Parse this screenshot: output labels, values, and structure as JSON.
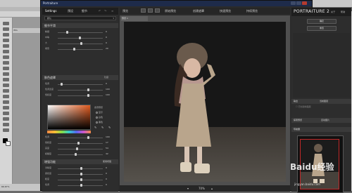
{
  "window": {
    "title": "Portraiture"
  },
  "left_panel": {
    "tabs": [
      "Settings",
      "预设",
      "细节"
    ],
    "preset_label": "默认",
    "section1": "细节平滑",
    "sliders1": [
      {
        "label": "精细",
        "value": "0"
      },
      {
        "label": "中等",
        "value": "0"
      },
      {
        "label": "大",
        "value": "0"
      },
      {
        "label": "阈值",
        "value": "20"
      }
    ],
    "section2": "肤色遮罩",
    "section2_btn": "隐藏",
    "sliders2": [
      {
        "label": "色调",
        "value": "0"
      },
      {
        "label": "色调宽度",
        "value": "100"
      },
      {
        "label": "饱和度",
        "value": "100"
      }
    ],
    "mask_options": [
      "显示",
      "白色",
      "黑色"
    ],
    "sliders3": [
      {
        "label": "色调",
        "value": "100"
      },
      {
        "label": "饱和度",
        "value": "17"
      },
      {
        "label": "亮度",
        "value": "54"
      },
      {
        "label": "模糊度",
        "value": "42"
      }
    ],
    "section3": "增强功能",
    "section3_btn": "使用增强",
    "sliders4": [
      {
        "label": "清晰度",
        "value": "0"
      },
      {
        "label": "柔和度",
        "value": "0"
      },
      {
        "label": "暖度",
        "value": "0"
      },
      {
        "label": "色调",
        "value": "0"
      }
    ]
  },
  "toolbar": {
    "style_label": "预览",
    "compare": "原始预览",
    "spot": "创建遮罩",
    "live": "快速预览",
    "flag": "持续预览"
  },
  "viewer": {
    "image_tab": "预览 1",
    "zoom": "70%"
  },
  "right_panel": {
    "logo": "PORTRAITURE 2",
    "about": "关于",
    "help": "帮助",
    "ok": "确定",
    "reset": "重置",
    "output_section": "输出",
    "output_value": "当前图层",
    "output_check": "已创建新图层",
    "preview_section": "探索预览",
    "auto_label": "自动图片",
    "navigator_section": "导航器"
  },
  "watermark": {
    "brand": "Baidu经验",
    "url": "jingyan.baidu.com"
  },
  "photoshop": {
    "zoom_status": "66.67%",
    "doc_name": "IMG"
  },
  "colors": {
    "accent_red": "#c02828",
    "panel_bg": "#2d2d2d",
    "title_bg": "#1e2b4a"
  }
}
